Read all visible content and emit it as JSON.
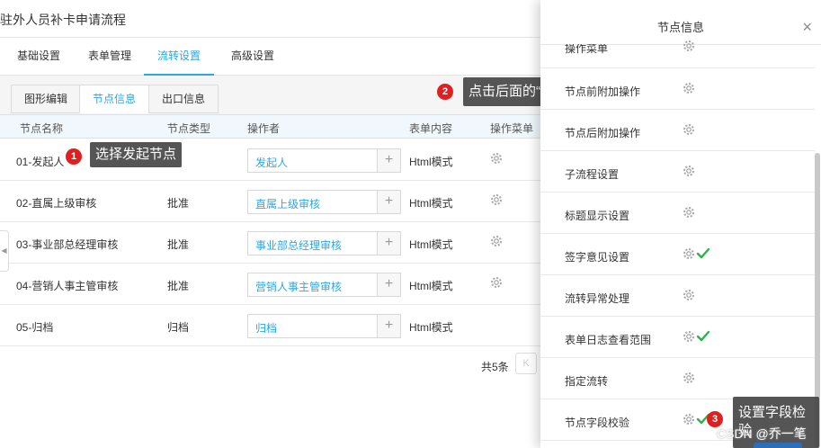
{
  "app": {
    "title": "驻外人员补卡申请流程"
  },
  "main_tabs": [
    {
      "label": "基础设置"
    },
    {
      "label": "表单管理"
    },
    {
      "label": "流转设置"
    },
    {
      "label": "高级设置"
    }
  ],
  "sub_tabs": [
    {
      "label": "图形编辑"
    },
    {
      "label": "节点信息"
    },
    {
      "label": "出口信息"
    }
  ],
  "table": {
    "headers": [
      "节点名称",
      "节点类型",
      "操作者",
      "表单内容",
      "操作菜单"
    ],
    "rows": [
      {
        "name": "01-发起人",
        "type": "",
        "operator": "发起人",
        "form": "Html模式"
      },
      {
        "name": "02-直属上级审核",
        "type": "批准",
        "operator": "直属上级审核",
        "form": "Html模式"
      },
      {
        "name": "03-事业部总经理审核",
        "type": "批准",
        "operator": "事业部总经理审核",
        "form": "Html模式"
      },
      {
        "name": "04-营销人事主管审核",
        "type": "批准",
        "operator": "营销人事主管审核",
        "form": "Html模式"
      },
      {
        "name": "05-归档",
        "type": "归档",
        "operator": "归档",
        "form": "Html模式"
      }
    ],
    "plus_symbol": "+"
  },
  "pager": {
    "total_text": "共5条",
    "prev_symbol": "K"
  },
  "left_handle": "◀",
  "drawer": {
    "title": "节点信息",
    "close_symbol": "×",
    "items": [
      {
        "label": "操作菜单",
        "checked": false
      },
      {
        "label": "节点前附加操作",
        "checked": false
      },
      {
        "label": "节点后附加操作",
        "checked": false
      },
      {
        "label": "子流程设置",
        "checked": false
      },
      {
        "label": "标题显示设置",
        "checked": false
      },
      {
        "label": "签字意见设置",
        "checked": true
      },
      {
        "label": "流转异常处理",
        "checked": false
      },
      {
        "label": "表单日志查看范围",
        "checked": true
      },
      {
        "label": "指定流转",
        "checked": false
      },
      {
        "label": "节点字段校验",
        "checked": true
      }
    ]
  },
  "annotations": [
    {
      "badge": "1",
      "text": "选择发起节点"
    },
    {
      "badge": "2",
      "text": "点击后面的“。。。”"
    },
    {
      "badge": "3",
      "text": "设置字段检验"
    }
  ],
  "watermark": "CSDN @乔一笔",
  "colors": {
    "accent": "#2ea7e0",
    "check": "#2bb24c",
    "badge": "#e02020"
  }
}
